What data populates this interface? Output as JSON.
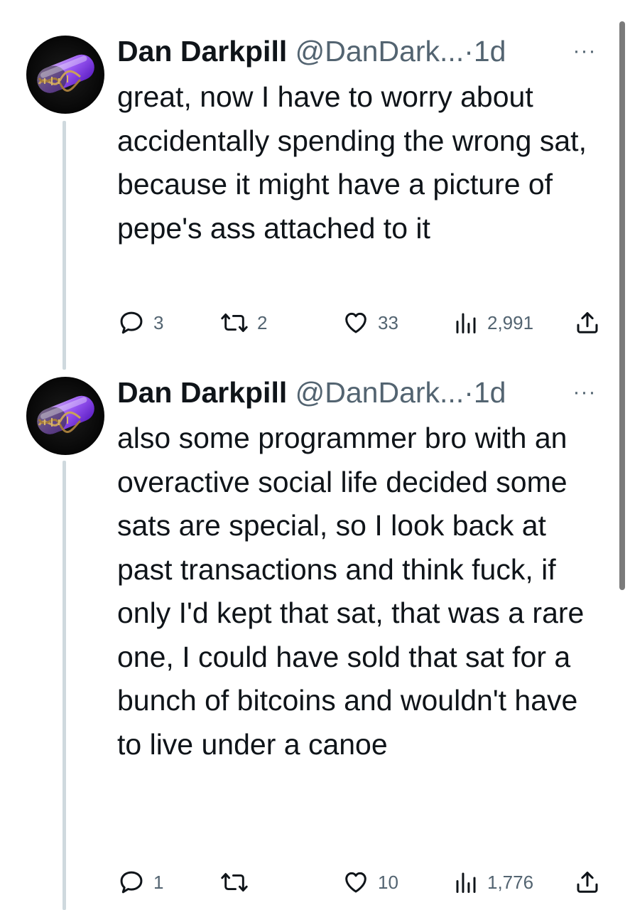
{
  "colors": {
    "text_primary": "#0f1419",
    "text_secondary": "#536471",
    "thread_line": "#cfd9de",
    "avatar_accent": "#9b4dff"
  },
  "icons": {
    "reply": "speech-bubble-icon",
    "retweet": "retweet-arrows-icon",
    "like": "heart-outline-icon",
    "views": "bar-chart-icon",
    "share": "share-upload-icon",
    "more": "more-dots-icon"
  },
  "tweets": [
    {
      "author_name": "Dan Darkpill",
      "handle": "@DanDark...",
      "separator": "·",
      "time": "1d",
      "more": "···",
      "text": "great, now I have to worry about accidentally spending the wrong sat, because it might have a picture of pepe's ass attached to it",
      "replies": "3",
      "retweets": "2",
      "likes": "33",
      "views": "2,991"
    },
    {
      "author_name": "Dan Darkpill",
      "handle": "@DanDark...",
      "separator": "·",
      "time": "1d",
      "more": "···",
      "text": "also some programmer bro with an overactive social life decided some sats are special, so I look back at past transactions and think fuck, if only I'd kept that sat, that was a rare one, I could have sold that sat for a bunch of bitcoins and wouldn't have to live under a canoe",
      "replies": "1",
      "retweets": "",
      "likes": "10",
      "views": "1,776"
    }
  ]
}
